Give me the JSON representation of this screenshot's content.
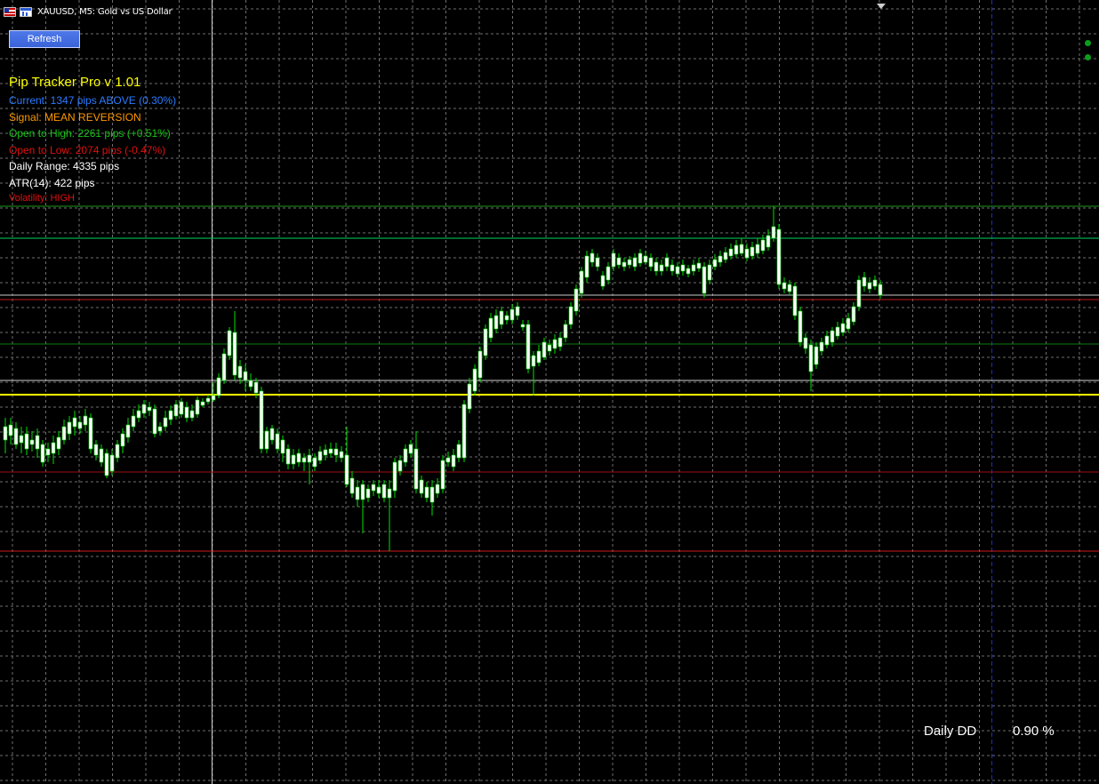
{
  "window": {
    "title": "XAUUSD, M5:  Gold vs US Dollar"
  },
  "toolbar": {
    "refresh_label": "Refresh"
  },
  "indicator": {
    "title": "Pip Tracker Pro v 1.01",
    "current": "Current: 1347 pips ABOVE (0.30%)",
    "signal": "Signal: MEAN REVERSION",
    "open_to_high": "Open to High: 2261 pips (+0.51%)",
    "open_to_low": "Open to Low: 2074 pips (-0.47%)",
    "daily_range": "Daily Range: 4335 pips",
    "atr": "ATR(14): 422 pips",
    "volatility": "Volatility: HIGH"
  },
  "indicator_colors": {
    "title": "#ffff00",
    "current": "#2a7bff",
    "signal": "#ff9900",
    "open_to_high": "#16c414",
    "open_to_low": "#e01010",
    "daily_range": "#ffffff",
    "atr": "#ffffff",
    "volatility": "#e01010"
  },
  "drawdown": {
    "label": "Daily DD",
    "value": "0.90 %"
  },
  "icons": {
    "chart_icon": "chart-flag-icon",
    "window_icon": "window-icon",
    "status_indicator": "green-dot-icon"
  },
  "colors": {
    "background": "#000000",
    "grid": "#6e6e6e",
    "candle_bull": "#ffffff",
    "candle_bear": "#ffffff",
    "candle_wick": "#00e000",
    "open_line": "#ffff00",
    "high_line": "#00a000",
    "low_line": "#c00000",
    "vertical_line": "#d0d0d0",
    "period_separator": "#1a2ec0"
  }
}
